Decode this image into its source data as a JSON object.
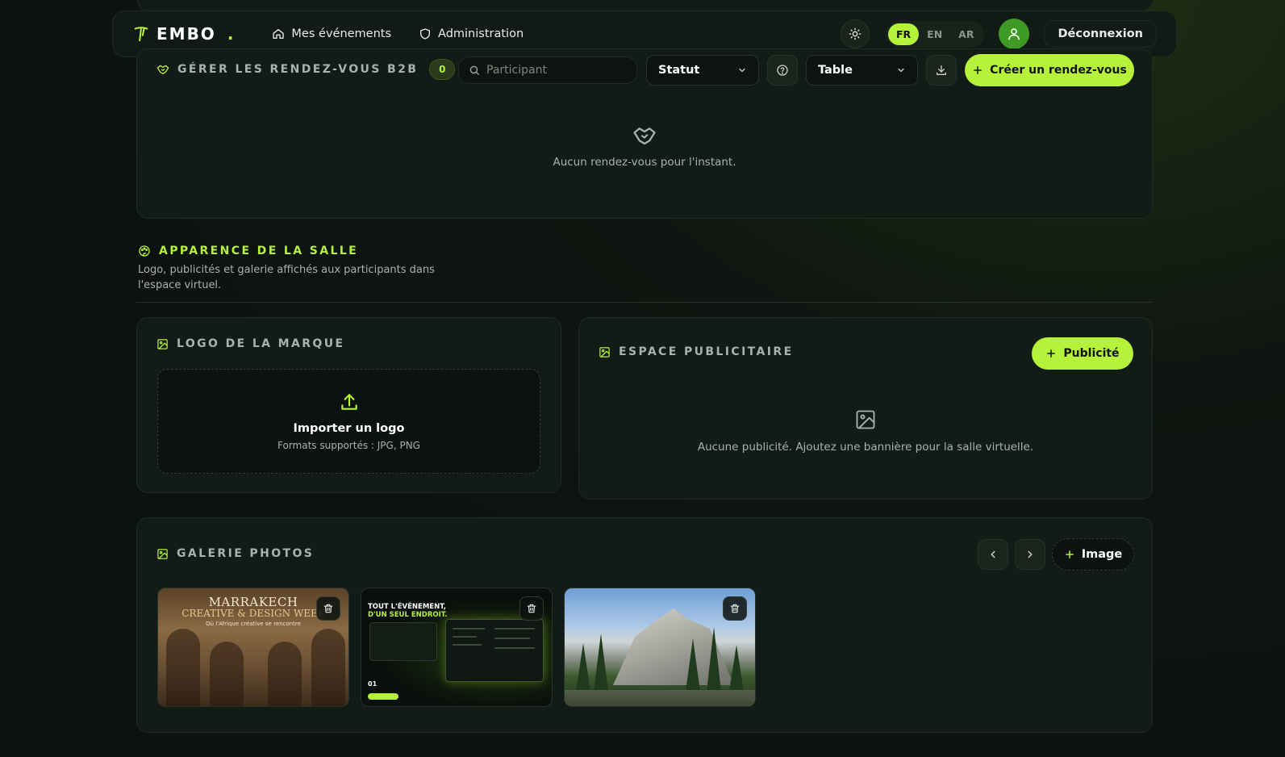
{
  "brand": {
    "name": "EMBO",
    "dot": ".",
    "accent": "#b6f23a"
  },
  "nav": {
    "items": [
      {
        "label": "Mes événements",
        "icon": "home-icon"
      },
      {
        "label": "Administration",
        "icon": "shield-icon"
      }
    ],
    "theme_icon": "sun-icon",
    "languages": [
      {
        "code": "FR",
        "active": true
      },
      {
        "code": "EN",
        "active": false
      },
      {
        "code": "AR",
        "active": false
      }
    ],
    "logout_label": "Déconnexion"
  },
  "b2b": {
    "title": "GÉRER LES RENDEZ-VOUS B2B",
    "count": "0",
    "search_placeholder": "Participant",
    "status_select": "Statut",
    "view_select": "Table",
    "create_label": "Créer un rendez-vous",
    "empty_text": "Aucun rendez-vous pour l'instant."
  },
  "appearance": {
    "title": "APPARENCE DE LA SALLE",
    "description": "Logo, publicités et galerie affichés aux participants dans l'espace virtuel."
  },
  "logo_card": {
    "title": "LOGO DE LA MARQUE",
    "upload_title": "Importer un logo",
    "upload_sub": "Formats supportés : JPG, PNG"
  },
  "ads_card": {
    "title": "ESPACE PUBLICITAIRE",
    "add_label": "Publicité",
    "empty_text": "Aucune publicité. Ajoutez une bannière pour la salle virtuelle."
  },
  "gallery": {
    "title": "GALERIE PHOTOS",
    "add_label": "Image",
    "thumb1": {
      "line1": "MARRAKECH",
      "line2": "CREATIVE & DESIGN WEEK",
      "line3": "Où l'Afrique créative se rencontre"
    },
    "thumb2": {
      "line1": "TOUT L'ÉVÉNEMENT,",
      "line2": "D'UN SEUL ENDROIT.",
      "num": "01"
    }
  }
}
